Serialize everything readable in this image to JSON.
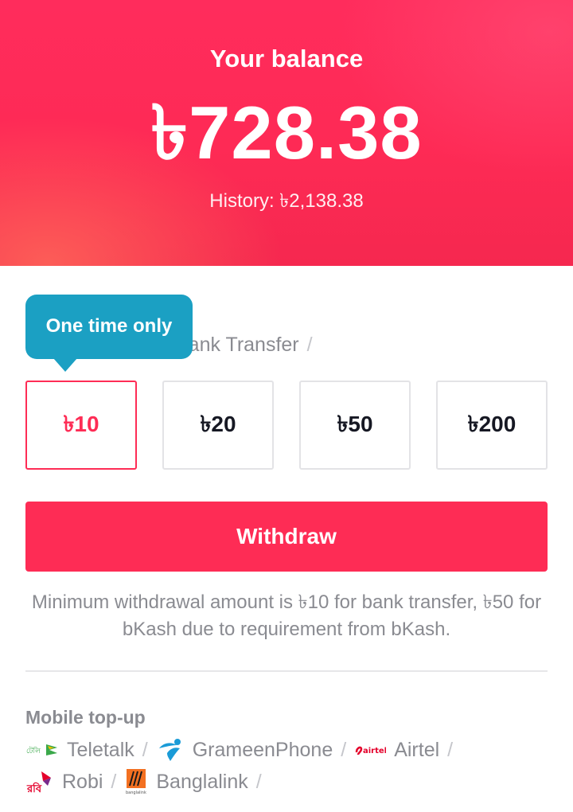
{
  "balance": {
    "label": "Your balance",
    "amount": "৳728.38",
    "history": "History: ৳2,138.38"
  },
  "methods": {
    "bank_transfer": "Bank Transfer",
    "separator": "/"
  },
  "tooltip": "One time only",
  "amount_options": [
    {
      "label": "৳10",
      "selected": true
    },
    {
      "label": "৳20",
      "selected": false
    },
    {
      "label": "৳50",
      "selected": false
    },
    {
      "label": "৳200",
      "selected": false
    }
  ],
  "withdraw_label": "Withdraw",
  "note": "Minimum withdrawal amount is ৳10 for bank transfer, ৳50 for bKash due to requirement from bKash.",
  "topup": {
    "title": "Mobile top-up",
    "operators": [
      {
        "name": "Teletalk",
        "icon": "teletalk-logo-icon"
      },
      {
        "name": "GrameenPhone",
        "icon": "grameenphone-logo-icon"
      },
      {
        "name": "Airtel",
        "icon": "airtel-logo-icon"
      },
      {
        "name": "Robi",
        "icon": "robi-logo-icon"
      },
      {
        "name": "Banglalink",
        "icon": "banglalink-logo-icon"
      }
    ],
    "separator": "/"
  },
  "colors": {
    "accent": "#fe2c55",
    "tooltip": "#1ba0c3",
    "muted_text": "#8a8b91"
  }
}
